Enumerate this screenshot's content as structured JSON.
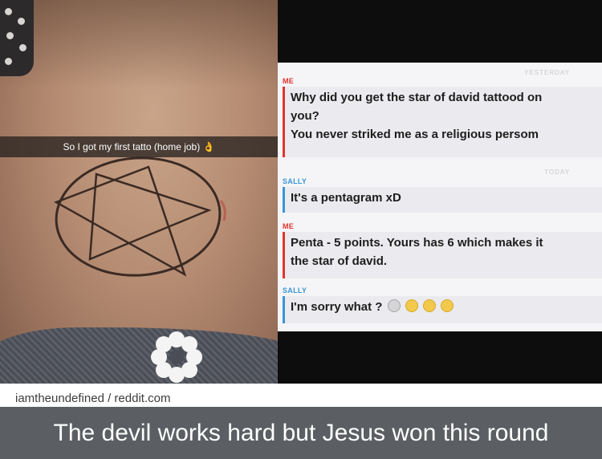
{
  "photo": {
    "snap_caption": "So I got my first tatto (home job) 👌"
  },
  "chat": {
    "timestamp_1": "YESTERDAY",
    "timestamp_2": "TODAY",
    "messages": [
      {
        "sender": "ME",
        "lines": [
          "Why did you get the star of david tattood on",
          "you?",
          "You never striked me as a religious persom"
        ]
      },
      {
        "sender": "SALLY",
        "lines": [
          "It's a pentagram xD"
        ]
      },
      {
        "sender": "ME",
        "lines": [
          "Penta - 5 points. Yours has 6 which makes it",
          "the star of david."
        ]
      },
      {
        "sender": "SALLY",
        "lines": [
          "I'm sorry what ?"
        ]
      }
    ]
  },
  "footer": {
    "credit": "iamtheundefined / reddit.com",
    "caption": "The devil works hard but Jesus won this round"
  },
  "colors": {
    "me_accent": "#e3342f",
    "sally_accent": "#3a95d6",
    "caption_bar": "#5b5f63"
  }
}
